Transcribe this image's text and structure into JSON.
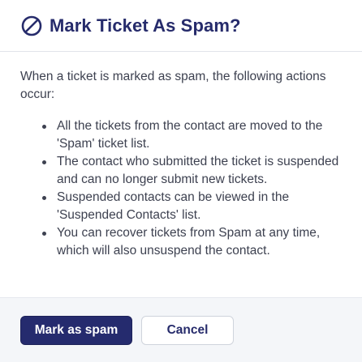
{
  "dialog": {
    "title": "Mark Ticket As Spam?",
    "title_icon": "ban-icon",
    "intro": "When a ticket is marked as spam, the following actions occur:",
    "actions": [
      "All the tickets from the contact are moved to the 'Spam' ticket list.",
      "The contact who submitted the ticket is suspended and can no longer submit new tickets.",
      "Suspended contacts can be viewed in the 'Suspended Contacts' list.",
      "You can recover tickets from Spam at any time, which will also unsuspend the contact."
    ],
    "primary_button": "Mark as spam",
    "cancel_button": "Cancel"
  },
  "colors": {
    "title": "#262b6b",
    "primary_button_bg": "#252b6e",
    "body_text": "#3d4150",
    "footer_bg": "#f4f6f9"
  }
}
